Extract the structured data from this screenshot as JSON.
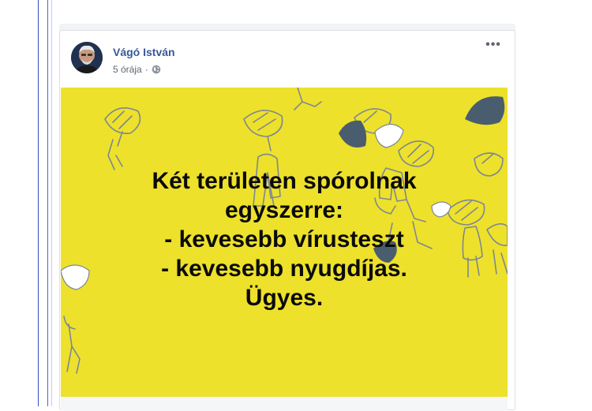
{
  "post": {
    "author": "Vágó István",
    "time": "5 órája",
    "separator": "·",
    "more": "•••",
    "image_text": [
      "Két területen spórolnak",
      "egyszerre:",
      "- kevesebb vírusteszt",
      "- kevesebb nyugdíjas.",
      "Ügyes."
    ]
  },
  "colors": {
    "image_background": "#ede12b",
    "author_link": "#385898",
    "meta_text": "#606770"
  },
  "icons": [
    "avatar-photo",
    "globe-icon",
    "more-options-icon"
  ]
}
